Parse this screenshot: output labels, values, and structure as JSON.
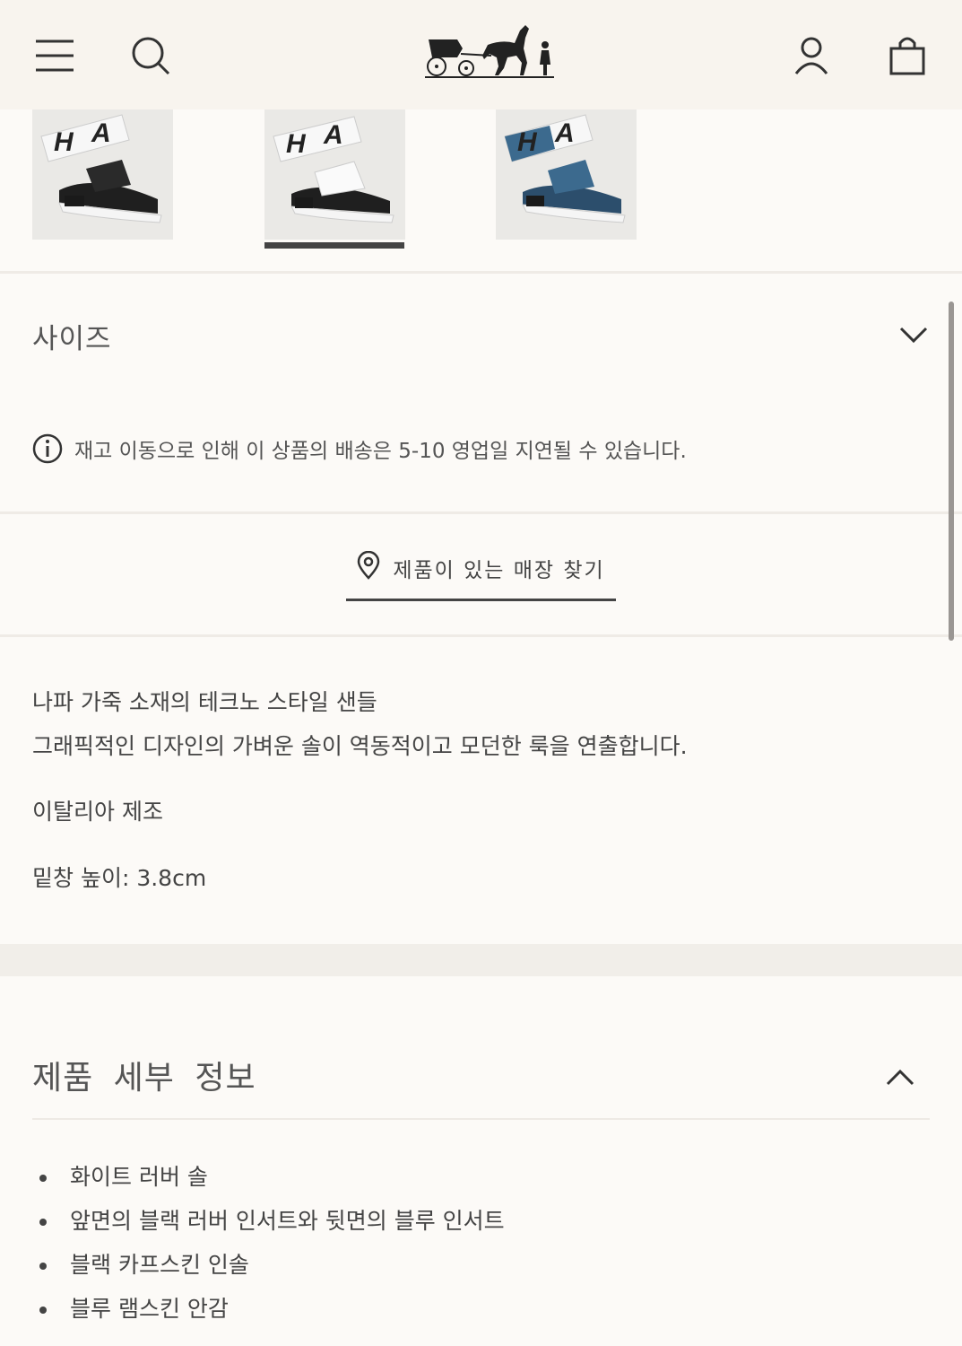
{
  "header": {
    "menu_icon": "hamburger-menu-icon",
    "search_icon": "search-icon",
    "logo_icon": "carriage-horse-logo",
    "account_icon": "user-icon",
    "bag_icon": "shopping-bag-icon"
  },
  "thumbnails": [
    {
      "color": "black",
      "selected": false
    },
    {
      "color": "white",
      "selected": true
    },
    {
      "color": "blue",
      "selected": false
    }
  ],
  "size": {
    "label": "사이즈",
    "icon": "chevron-down-icon"
  },
  "notice": {
    "icon": "info-icon",
    "text": "재고 이동으로 인해 이 상품의 배송은 5-10 영업일 지연될 수 있습니다."
  },
  "store_finder": {
    "icon": "location-pin-icon",
    "label": "제품이 있는 매장 찾기"
  },
  "description": {
    "line1": "나파 가죽 소재의 테크노 스타일 샌들",
    "line2": "그래픽적인 디자인의 가벼운 솔이 역동적이고 모던한 룩을 연출합니다.",
    "origin": "이탈리아 제조",
    "sole_height": "밑창 높이: 3.8cm"
  },
  "details": {
    "title": "제품 세부 정보",
    "icon": "chevron-up-icon",
    "items": [
      "화이트 러버 솔",
      "앞면의 블랙 러버 인서트와 뒷면의 블루 인서트",
      "블랙 카프스킨 인솔",
      "블루 램스킨 안감"
    ]
  },
  "colors": {
    "background": "#fcfaf7",
    "header_bg": "#f8f4ee",
    "text": "#444444"
  }
}
